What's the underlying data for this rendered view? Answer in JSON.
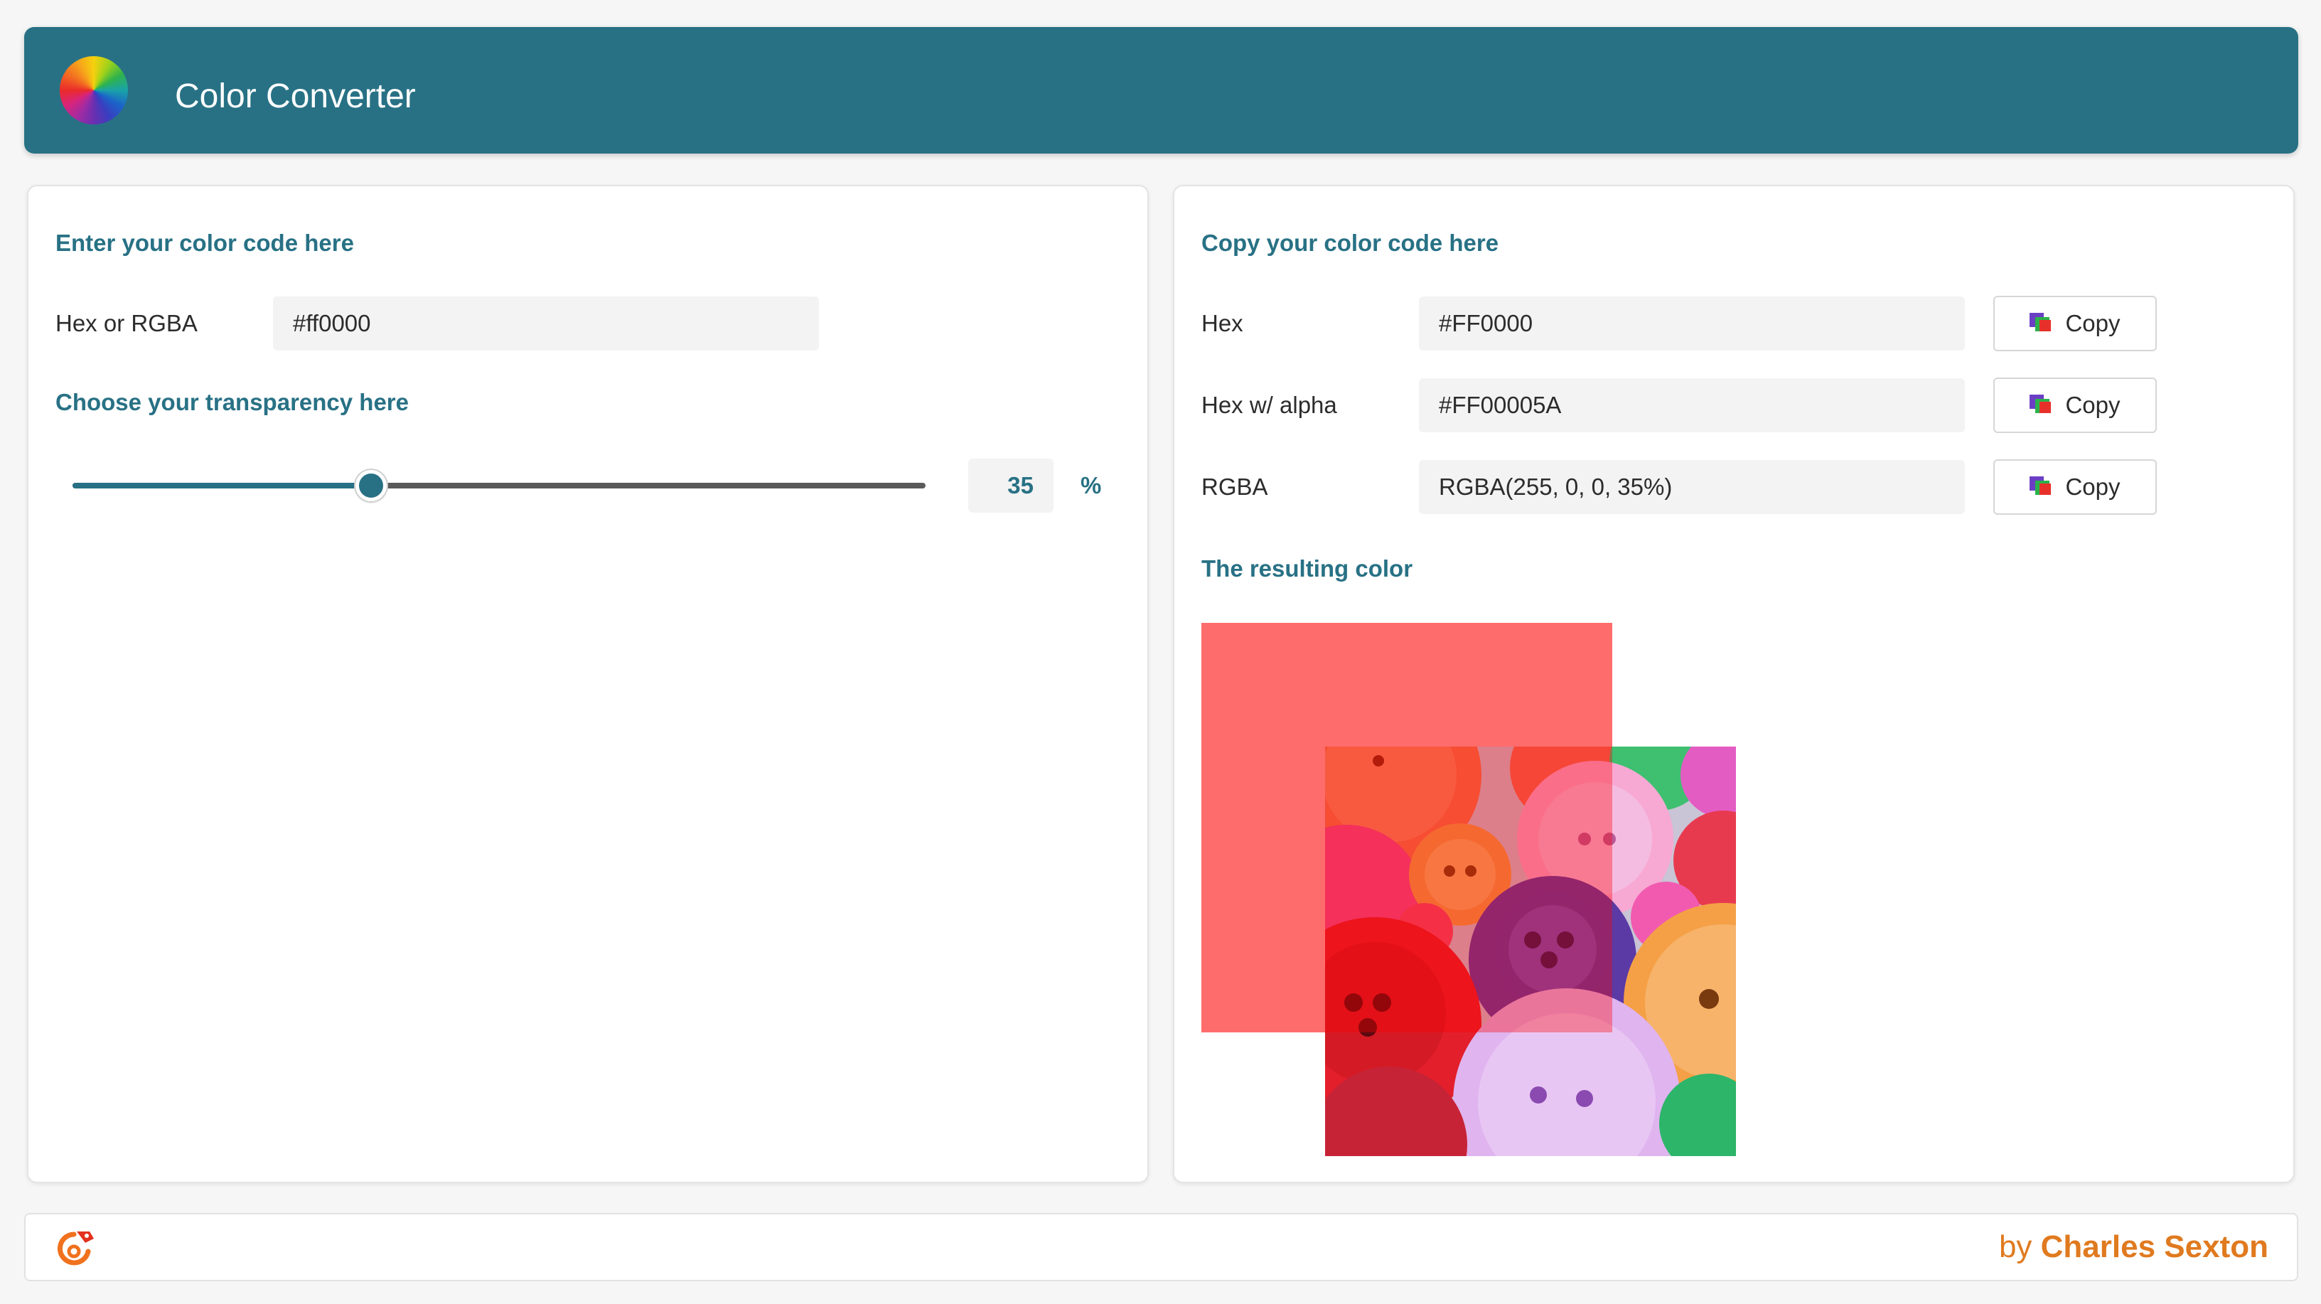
{
  "app": {
    "title": "Color Converter",
    "logo_icon": "color-wheel-icon"
  },
  "input_panel": {
    "heading": "Enter your color code here",
    "hex_label": "Hex or RGBA",
    "hex_value": "#ff0000",
    "transparency_heading": "Choose your transparency here",
    "transparency_value": "35",
    "transparency_fraction": 0.35,
    "percent_symbol": "%"
  },
  "output_panel": {
    "heading": "Copy your color code here",
    "rows": [
      {
        "label": "Hex",
        "value": "#FF0000",
        "button": "Copy"
      },
      {
        "label": "Hex w/ alpha",
        "value": "#FF00005A",
        "button": "Copy"
      },
      {
        "label": "RGBA",
        "value": "RGBA(255, 0, 0, 35%)",
        "button": "Copy"
      }
    ],
    "result_heading": "The resulting color",
    "result_color": "rgba(255, 0, 0, 0.35)",
    "copy_icon": "copy-icon"
  },
  "footer": {
    "mascot_icon": "chameleon-logo-icon",
    "credit_prefix": "by",
    "credit_name": "Charles Sexton"
  },
  "colors": {
    "accent": "#287185",
    "footer_accent": "#e07a1f",
    "background": "#f6f6f6"
  }
}
